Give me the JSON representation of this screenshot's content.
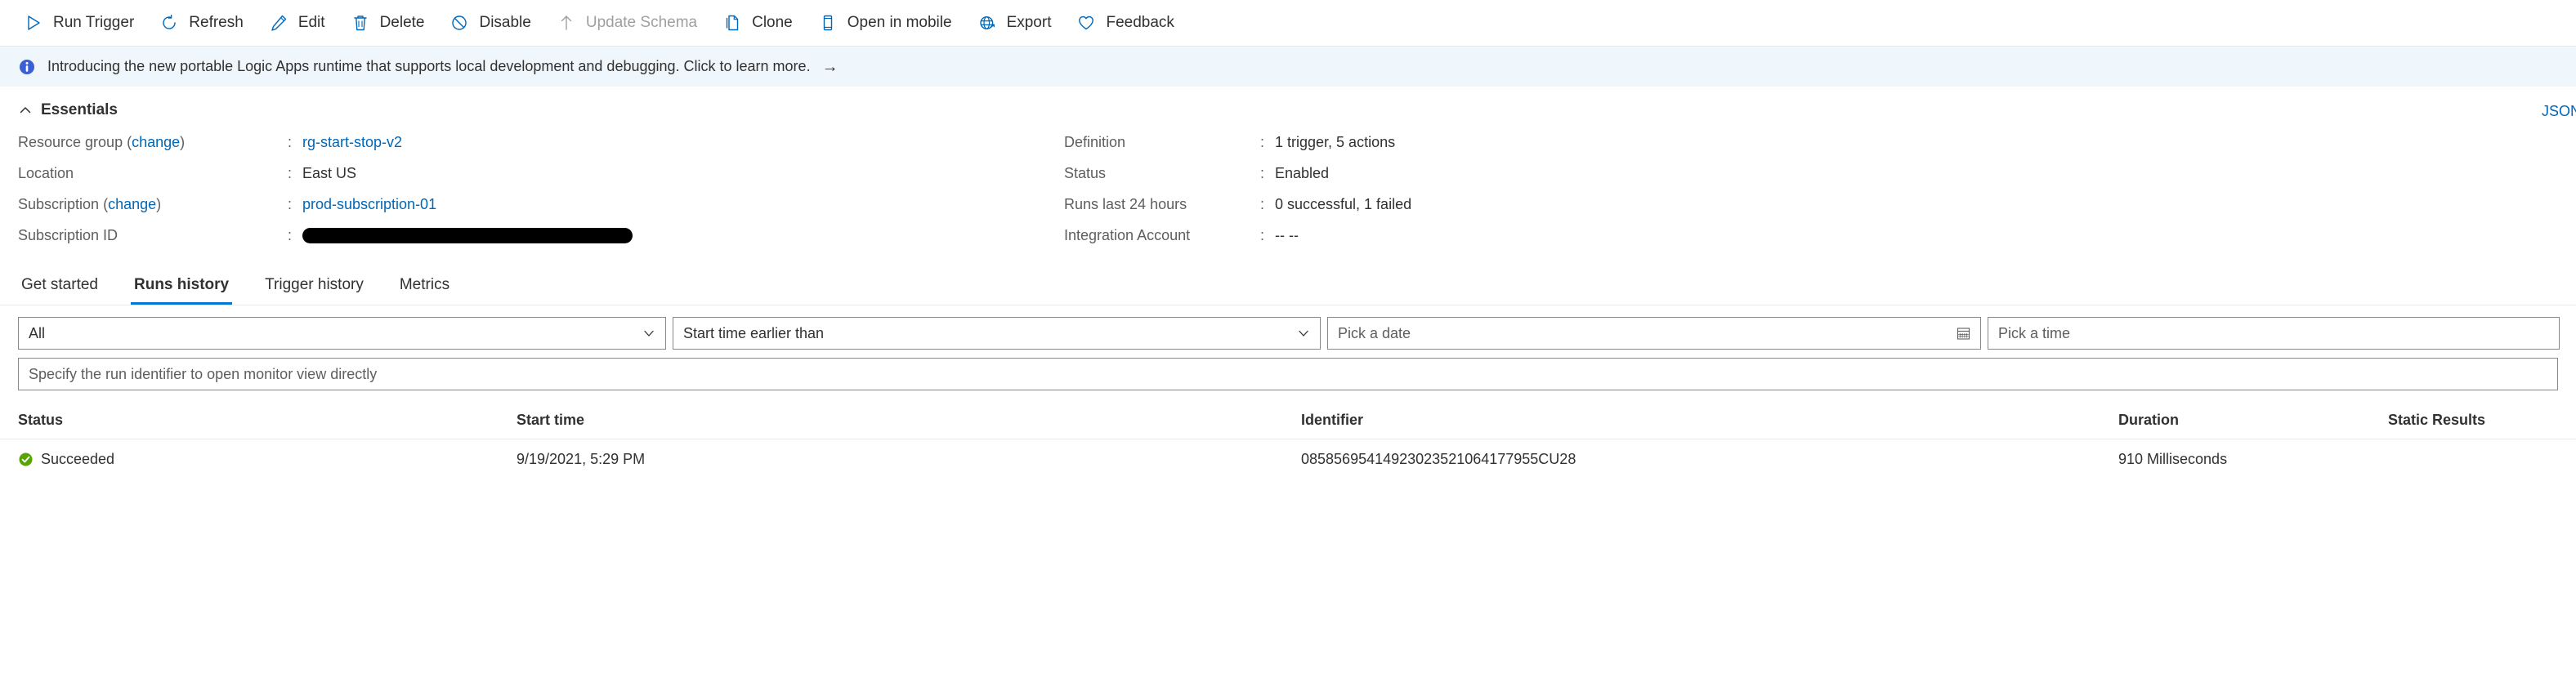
{
  "commandbar": {
    "items": [
      {
        "label": "Run Trigger",
        "icon": "play-icon",
        "disabled": false
      },
      {
        "label": "Refresh",
        "icon": "refresh-icon",
        "disabled": false
      },
      {
        "label": "Edit",
        "icon": "pencil-icon",
        "disabled": false
      },
      {
        "label": "Delete",
        "icon": "trash-icon",
        "disabled": false
      },
      {
        "label": "Disable",
        "icon": "disable-icon",
        "disabled": false
      },
      {
        "label": "Update Schema",
        "icon": "arrow-up-icon",
        "disabled": true
      },
      {
        "label": "Clone",
        "icon": "copy-icon",
        "disabled": false
      },
      {
        "label": "Open in mobile",
        "icon": "mobile-icon",
        "disabled": false
      },
      {
        "label": "Export",
        "icon": "globe-export-icon",
        "disabled": false
      },
      {
        "label": "Feedback",
        "icon": "heart-icon",
        "disabled": false
      }
    ]
  },
  "banner": {
    "icon": "info-icon",
    "text": "Introducing the new portable Logic Apps runtime that supports local development and debugging. Click to learn more.",
    "arrow": "→",
    "background": "#eff6fc"
  },
  "essentials": {
    "title": "Essentials",
    "collapse_icon": "chevron-up-icon",
    "json_link": "JSON",
    "left": [
      {
        "label": "Resource group",
        "label_link": "change",
        "colon": ":",
        "value": "rg-start-stop-v2",
        "is_link": true
      },
      {
        "label": "Location",
        "label_link": "",
        "colon": ":",
        "value": "East US",
        "is_link": false
      },
      {
        "label": "Subscription",
        "label_link": "change",
        "colon": ":",
        "value": "prod-subscription-01",
        "is_link": true
      },
      {
        "label": "Subscription ID",
        "label_link": "",
        "colon": ":",
        "value": "",
        "is_link": false,
        "redacted": true
      }
    ],
    "right": [
      {
        "label": "Definition",
        "colon": ":",
        "value": "1 trigger, 5 actions"
      },
      {
        "label": "Status",
        "colon": ":",
        "value": "Enabled"
      },
      {
        "label": "Runs last 24 hours",
        "colon": ":",
        "value": "0 successful, 1 failed"
      },
      {
        "label": "Integration Account",
        "colon": ":",
        "value": "-- --"
      }
    ]
  },
  "tabs": [
    {
      "label": "Get started",
      "active": false
    },
    {
      "label": "Runs history",
      "active": true
    },
    {
      "label": "Trigger history",
      "active": false
    },
    {
      "label": "Metrics",
      "active": false
    }
  ],
  "filters": {
    "status": {
      "value": "All",
      "caret_icon": "chevron-down-icon"
    },
    "timefilter": {
      "value": "Start time earlier than",
      "caret_icon": "chevron-down-icon"
    },
    "date": {
      "placeholder": "Pick a date",
      "icon": "calendar-icon"
    },
    "time": {
      "placeholder": "Pick a time"
    },
    "search": {
      "placeholder": "Specify the run identifier to open monitor view directly"
    }
  },
  "table": {
    "columns": [
      "Status",
      "Start time",
      "Identifier",
      "Duration",
      "Static Results"
    ],
    "rows": [
      {
        "status": "Succeeded",
        "status_icon": "success-check-icon",
        "status_color": "#57a300",
        "start_time": "9/19/2021, 5:29 PM",
        "identifier": "08585695414923023521064177955CU28",
        "duration": "910 Milliseconds",
        "static_results": ""
      }
    ]
  },
  "colors": {
    "accent": "#0078d4",
    "link": "#0067b8",
    "success": "#57a300",
    "banner_bg": "#eff6fc",
    "muted": "#605e5c",
    "disabled": "#a19f9d"
  }
}
